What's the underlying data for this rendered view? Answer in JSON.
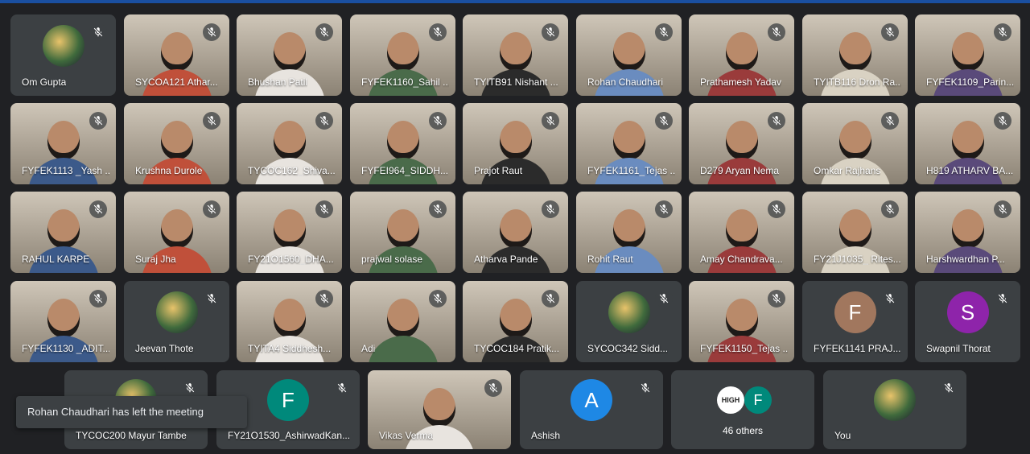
{
  "meeting": {
    "rows": [
      [
        {
          "name": "Om Gupta",
          "type": "avatar-image",
          "avatar_icon": "colorful-burst-avatar-icon"
        },
        {
          "name": "SYCOA121 Athar...",
          "type": "camera"
        },
        {
          "name": "Bhushan Patil",
          "type": "camera"
        },
        {
          "name": "FYFEK1160_Sahil ...",
          "type": "camera"
        },
        {
          "name": "TYITB91 Nishant ...",
          "type": "camera"
        },
        {
          "name": "Rohan Chaudhari",
          "type": "camera"
        },
        {
          "name": "Prathamesh Yadav",
          "type": "camera"
        },
        {
          "name": "TYITB116 Dron Ra...",
          "type": "camera"
        },
        {
          "name": "FYFEK1109_Parin...",
          "type": "camera"
        }
      ],
      [
        {
          "name": "FYFEK1113 _Yash ...",
          "type": "camera"
        },
        {
          "name": "Krushna Durole",
          "type": "camera"
        },
        {
          "name": "TYCOC162_Shiva...",
          "type": "camera"
        },
        {
          "name": "FYFEI964_SIDDH...",
          "type": "camera"
        },
        {
          "name": "Prajot Raut",
          "type": "camera"
        },
        {
          "name": "FYFEK1161_Tejas ...",
          "type": "camera"
        },
        {
          "name": "D279 Aryan Nema",
          "type": "camera"
        },
        {
          "name": "Omkar Rajhans",
          "type": "camera"
        },
        {
          "name": "H819 ATHARV BA...",
          "type": "camera"
        }
      ],
      [
        {
          "name": "RAHUL KARPE",
          "type": "camera"
        },
        {
          "name": "Suraj Jha",
          "type": "camera"
        },
        {
          "name": "FY21O1560_DHA...",
          "type": "camera"
        },
        {
          "name": "prajwal solase",
          "type": "camera"
        },
        {
          "name": "Atharva Pande",
          "type": "camera"
        },
        {
          "name": "Rohit Raut",
          "type": "camera"
        },
        {
          "name": "Amay Chandrava...",
          "type": "camera"
        },
        {
          "name": "FY21J1035_ Rites...",
          "type": "camera"
        },
        {
          "name": "Harshwardhan P...",
          "type": "camera"
        }
      ],
      [
        {
          "name": "FYFEK1130 _ADIT...",
          "type": "camera"
        },
        {
          "name": "Jeevan Thote",
          "type": "avatar-image",
          "avatar_icon": "person-photo-avatar-icon"
        },
        {
          "name": "TYITA4 Siddhesh...",
          "type": "camera"
        },
        {
          "name": "Adi",
          "type": "camera"
        },
        {
          "name": "TYCOC184 Pratik...",
          "type": "camera"
        },
        {
          "name": "SYCOC342 Sidd...",
          "type": "avatar-image",
          "avatar_icon": "panda-avatar-icon"
        },
        {
          "name": "FYFEK1150_Tejas ...",
          "type": "camera"
        },
        {
          "name": "FYFEK1141 PRAJ...",
          "type": "letter",
          "letter": "F",
          "color": "#a1775e"
        },
        {
          "name": "Swapnil Thorat",
          "type": "letter",
          "letter": "S",
          "color": "#8e24aa"
        }
      ]
    ],
    "bottom_row": [
      {
        "name": "TYCOC200 Mayur Tambe",
        "type": "avatar-image",
        "avatar_icon": "person-avatar-icon"
      },
      {
        "name": "FY21O1530_AshirwadKan...",
        "type": "letter",
        "letter": "F",
        "color": "#00897b"
      },
      {
        "name": "Vikas Verma",
        "type": "camera"
      },
      {
        "name": "Ashish",
        "type": "letter",
        "letter": "A",
        "color": "#1e88e5"
      },
      {
        "name": "",
        "type": "others",
        "others_label": "46 others",
        "logo_text": "HIGH",
        "letter": "F",
        "color": "#00897b"
      },
      {
        "name": "You",
        "type": "avatar-image",
        "avatar_icon": "dragon-avatar-icon"
      }
    ],
    "toast": "Rohan Chaudhari has left the meeting",
    "mic_icon": "mic-off-icon"
  }
}
